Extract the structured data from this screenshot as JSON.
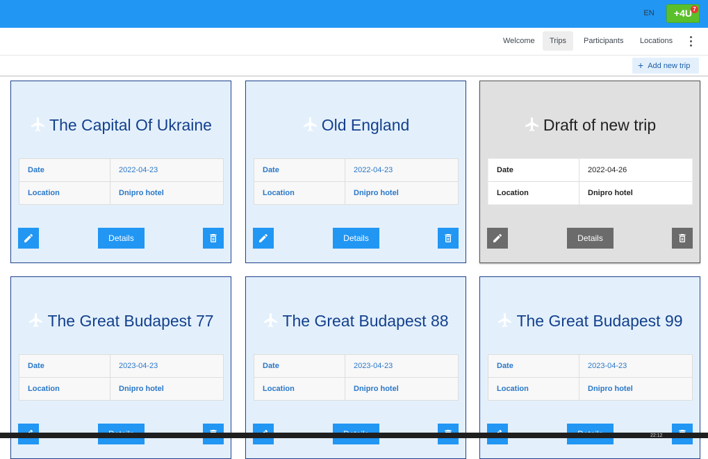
{
  "header": {
    "language": "EN",
    "brand_label": "+4U",
    "brand_badge": "7",
    "brand_color": "#5bbf2c",
    "bar_color": "#2196f3"
  },
  "nav": {
    "items": [
      {
        "label": "Welcome"
      },
      {
        "label": "Trips"
      },
      {
        "label": "Participants"
      },
      {
        "label": "Locations"
      }
    ],
    "active": "Trips",
    "more_icon": "more-vertical-icon"
  },
  "actions": {
    "add_trip_label": "Add new trip",
    "add_icon": "plus-icon"
  },
  "labels": {
    "date": "Date",
    "location": "Location",
    "details": "Details"
  },
  "trips": [
    {
      "title": "The Capital Of Ukraine",
      "date": "2022-04-23",
      "location": "Dnipro hotel",
      "draft": false
    },
    {
      "title": "Old England",
      "date": "2022-04-23",
      "location": "Dnipro hotel",
      "draft": false
    },
    {
      "title": "Draft of new trip",
      "date": "2022-04-26",
      "location": "Dnipro hotel",
      "draft": true
    },
    {
      "title": "The Great Budapest 77",
      "date": "2023-04-23",
      "location": "Dnipro hotel",
      "draft": false
    },
    {
      "title": "The Great Budapest 88",
      "date": "2023-04-23",
      "location": "Dnipro hotel",
      "draft": false
    },
    {
      "title": "The Great Budapest 99",
      "date": "2023-04-23",
      "location": "Dnipro hotel",
      "draft": false
    }
  ],
  "taskbar": {
    "clock": "22:12"
  }
}
